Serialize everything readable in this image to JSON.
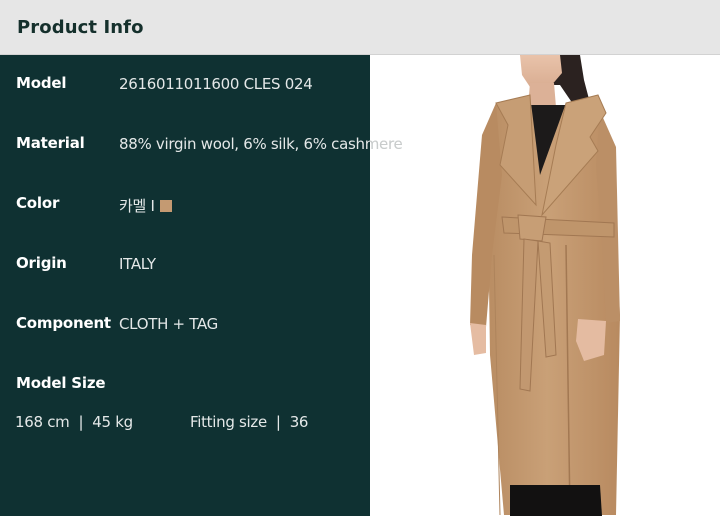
{
  "header": {
    "title": "Product Info"
  },
  "info": {
    "model": {
      "label": "Model",
      "value": "2616011011600 CLES 024"
    },
    "material": {
      "label": "Material",
      "value": "88% virgin wool, 6% silk, 6% cashmere"
    },
    "color": {
      "label": "Color",
      "value": "카멜 I",
      "swatch": "#c49a72"
    },
    "origin": {
      "label": "Origin",
      "value": "ITALY"
    },
    "component": {
      "label": "Component",
      "value": "CLOTH + TAG"
    }
  },
  "model_size": {
    "label": "Model Size",
    "height": "168 cm",
    "weight": "45 kg",
    "separator": "|",
    "fitting_label": "Fitting size",
    "fitting_value": "36"
  },
  "colors": {
    "header_bg": "#e6e6e6",
    "panel_bg": "#0f3132",
    "coat": "#c49a72"
  },
  "image": {
    "subject": "model-wearing-camel-wrap-coat"
  }
}
